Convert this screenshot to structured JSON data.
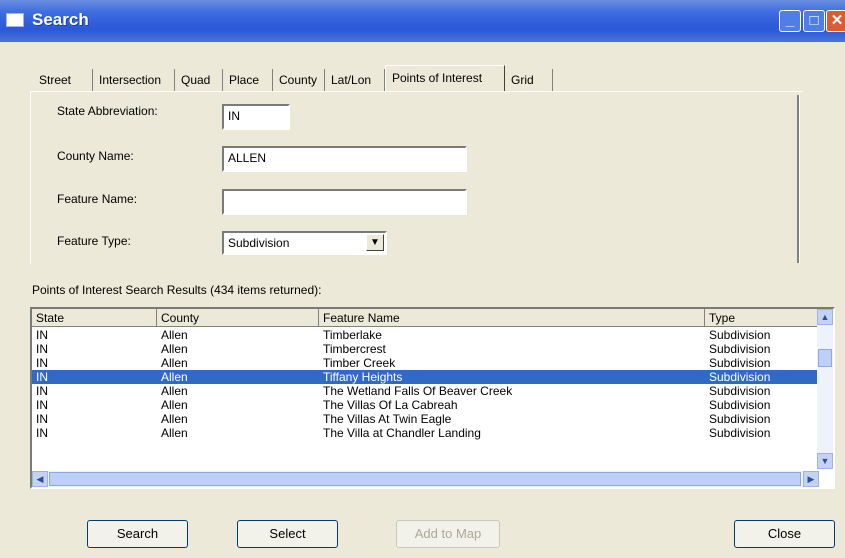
{
  "window": {
    "title": "Search"
  },
  "tabs": [
    {
      "label": "Street"
    },
    {
      "label": "Intersection"
    },
    {
      "label": "Quad"
    },
    {
      "label": "Place"
    },
    {
      "label": "County"
    },
    {
      "label": "Lat/Lon"
    },
    {
      "label": "Points of Interest",
      "active": true
    },
    {
      "label": "Grid"
    }
  ],
  "form": {
    "state_label": "State Abbreviation:",
    "state_value": "IN",
    "county_label": "County Name:",
    "county_value": "ALLEN",
    "feature_name_label": "Feature Name:",
    "feature_name_value": "",
    "feature_type_label": "Feature Type:",
    "feature_type_value": "Subdivision"
  },
  "results": {
    "label": "Points of Interest Search Results (434 items returned):",
    "columns": [
      "State",
      "County",
      "Feature Name",
      "Type"
    ],
    "rows": [
      [
        "IN",
        "Allen",
        "Timberlake",
        "Subdivision"
      ],
      [
        "IN",
        "Allen",
        "Timbercrest",
        "Subdivision"
      ],
      [
        "IN",
        "Allen",
        "Timber Creek",
        "Subdivision"
      ],
      [
        "IN",
        "Allen",
        "Tiffany Heights",
        "Subdivision"
      ],
      [
        "IN",
        "Allen",
        "The Wetland Falls Of Beaver Creek",
        "Subdivision"
      ],
      [
        "IN",
        "Allen",
        "The Villas Of La Cabreah",
        "Subdivision"
      ],
      [
        "IN",
        "Allen",
        "The Villas At Twin Eagle",
        "Subdivision"
      ],
      [
        "IN",
        "Allen",
        "The Villa at Chandler Landing",
        "Subdivision"
      ]
    ],
    "selected_row": 3
  },
  "buttons": {
    "search": "Search",
    "select": "Select",
    "add_to_map": "Add to Map",
    "close": "Close"
  }
}
